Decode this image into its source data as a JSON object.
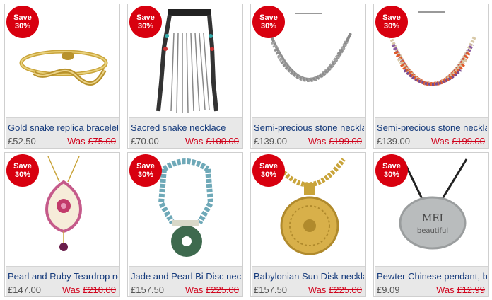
{
  "products": [
    {
      "badge_line1": "Save",
      "badge_line2": "30%",
      "name": "Gold snake replica bracelet",
      "price": "£52.50",
      "was_label": "Was ",
      "was_price": "£75.00",
      "image_icon": "gold-snake-bracelet-image"
    },
    {
      "badge_line1": "Save",
      "badge_line2": "30%",
      "name": "Sacred snake necklace",
      "price": "£70.00",
      "was_label": "Was ",
      "was_price": "£100.00",
      "image_icon": "beaded-tassel-necklace-image"
    },
    {
      "badge_line1": "Save",
      "badge_line2": "30%",
      "name": "Semi-precious stone necklace",
      "price": "£139.00",
      "was_label": "Was ",
      "was_price": "£199.00",
      "image_icon": "silver-bib-necklace-image"
    },
    {
      "badge_line1": "Save",
      "badge_line2": "30%",
      "name": "Semi-precious stone necklace",
      "price": "£139.00",
      "was_label": "Was ",
      "was_price": "£199.00",
      "image_icon": "coral-stone-bib-necklace-image"
    },
    {
      "badge_line1": "Save",
      "badge_line2": "30%",
      "name": "Pearl and Ruby Teardrop necklace",
      "price": "£147.00",
      "was_label": "Was ",
      "was_price": "£210.00",
      "image_icon": "pearl-ruby-pendant-image"
    },
    {
      "badge_line1": "Save",
      "badge_line2": "30%",
      "name": "Jade and Pearl Bi Disc necklace",
      "price": "£157.50",
      "was_label": "Was ",
      "was_price": "£225.00",
      "image_icon": "jade-disc-necklace-image"
    },
    {
      "badge_line1": "Save",
      "badge_line2": "30%",
      "name": "Babylonian Sun Disk necklace",
      "price": "£157.50",
      "was_label": "Was ",
      "was_price": "£225.00",
      "image_icon": "gold-sun-disk-necklace-image"
    },
    {
      "badge_line1": "Save",
      "badge_line2": "30%",
      "name": "Pewter Chinese pendant, beautiful",
      "price": "£9.09",
      "was_label": "Was ",
      "was_price": "£12.99",
      "image_icon": "pewter-pendant-image",
      "pendant_text_1": "MEI",
      "pendant_text_2": "beautiful"
    }
  ],
  "colors": {
    "badge": "#d8000f",
    "name": "#163b7c",
    "was": "#d0021b",
    "info_bg": "#e8e8e8"
  }
}
